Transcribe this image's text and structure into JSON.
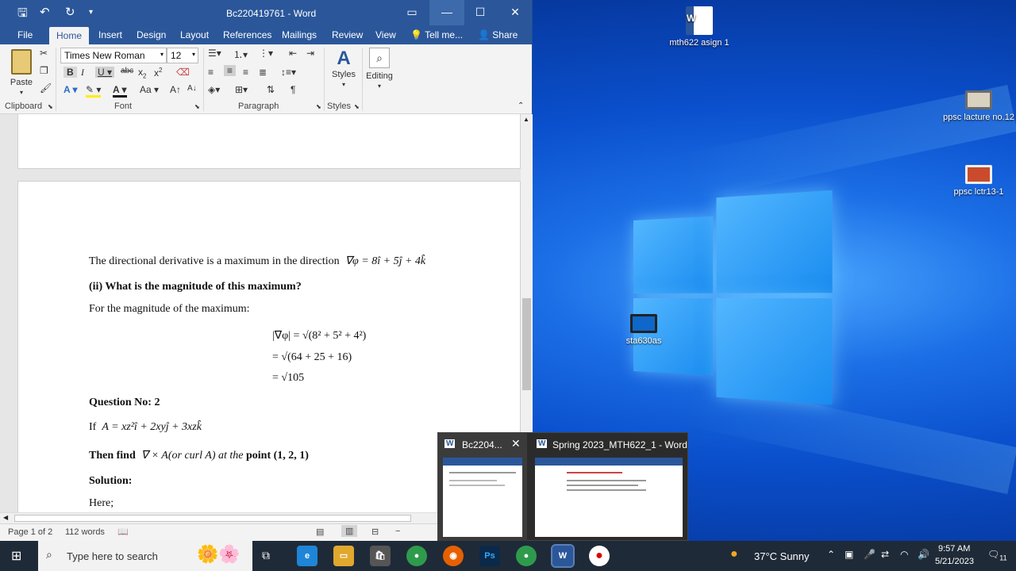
{
  "window": {
    "title": "Bc220419761 - Word"
  },
  "tabs": [
    "File",
    "Home",
    "Insert",
    "Design",
    "Layout",
    "References",
    "Mailings",
    "Review",
    "View"
  ],
  "tell_me": "Tell me...",
  "share": "Share",
  "ribbon": {
    "paste": "Paste",
    "font_name": "Times New Roman",
    "font_size": "12",
    "styles": "Styles",
    "editing": "Editing",
    "groups": {
      "clipboard": "Clipboard",
      "font": "Font",
      "paragraph": "Paragraph",
      "styles": "Styles"
    }
  },
  "document": {
    "line1": "The directional derivative is a maximum in the direction",
    "line1_math": "∇φ = 8î + 5ĵ + 4k̂",
    "q_ii": "(ii) What is the magnitude of this maximum?",
    "line2": "For the magnitude of the maximum:",
    "eq1": "|∇φ| = √(8² + 5² + 4²)",
    "eq2": "= √(64 + 25 + 16)",
    "eq3": "= √105",
    "question2": "Question No: 2",
    "if_line": "If",
    "if_math": "A = xz²î + 2xyĵ + 3xzk̂",
    "then_find": "Then find",
    "then_math": "∇ × A(or curl A) at the",
    "point": "point (1, 2, 1)",
    "solution": "Solution:",
    "here": "Here;"
  },
  "status": {
    "page": "Page 1 of 2",
    "words": "112 words"
  },
  "thumbnails": [
    {
      "title": "Bc2204..."
    },
    {
      "title": "Spring 2023_MTH622_1 - Word"
    }
  ],
  "desktop_icons": [
    {
      "label": "mth622 asign 1"
    },
    {
      "label": "ppsc lacture no.12"
    },
    {
      "label": "ppsc lctr13-1"
    },
    {
      "label": "sta630as"
    }
  ],
  "taskbar": {
    "search_placeholder": "Type here to search",
    "weather": "37°C  Sunny",
    "time": "9:57 AM",
    "date": "5/21/2023",
    "notifications": "11"
  },
  "colors": {
    "word_blue": "#2b579a",
    "taskbar": "#1f2a38"
  }
}
